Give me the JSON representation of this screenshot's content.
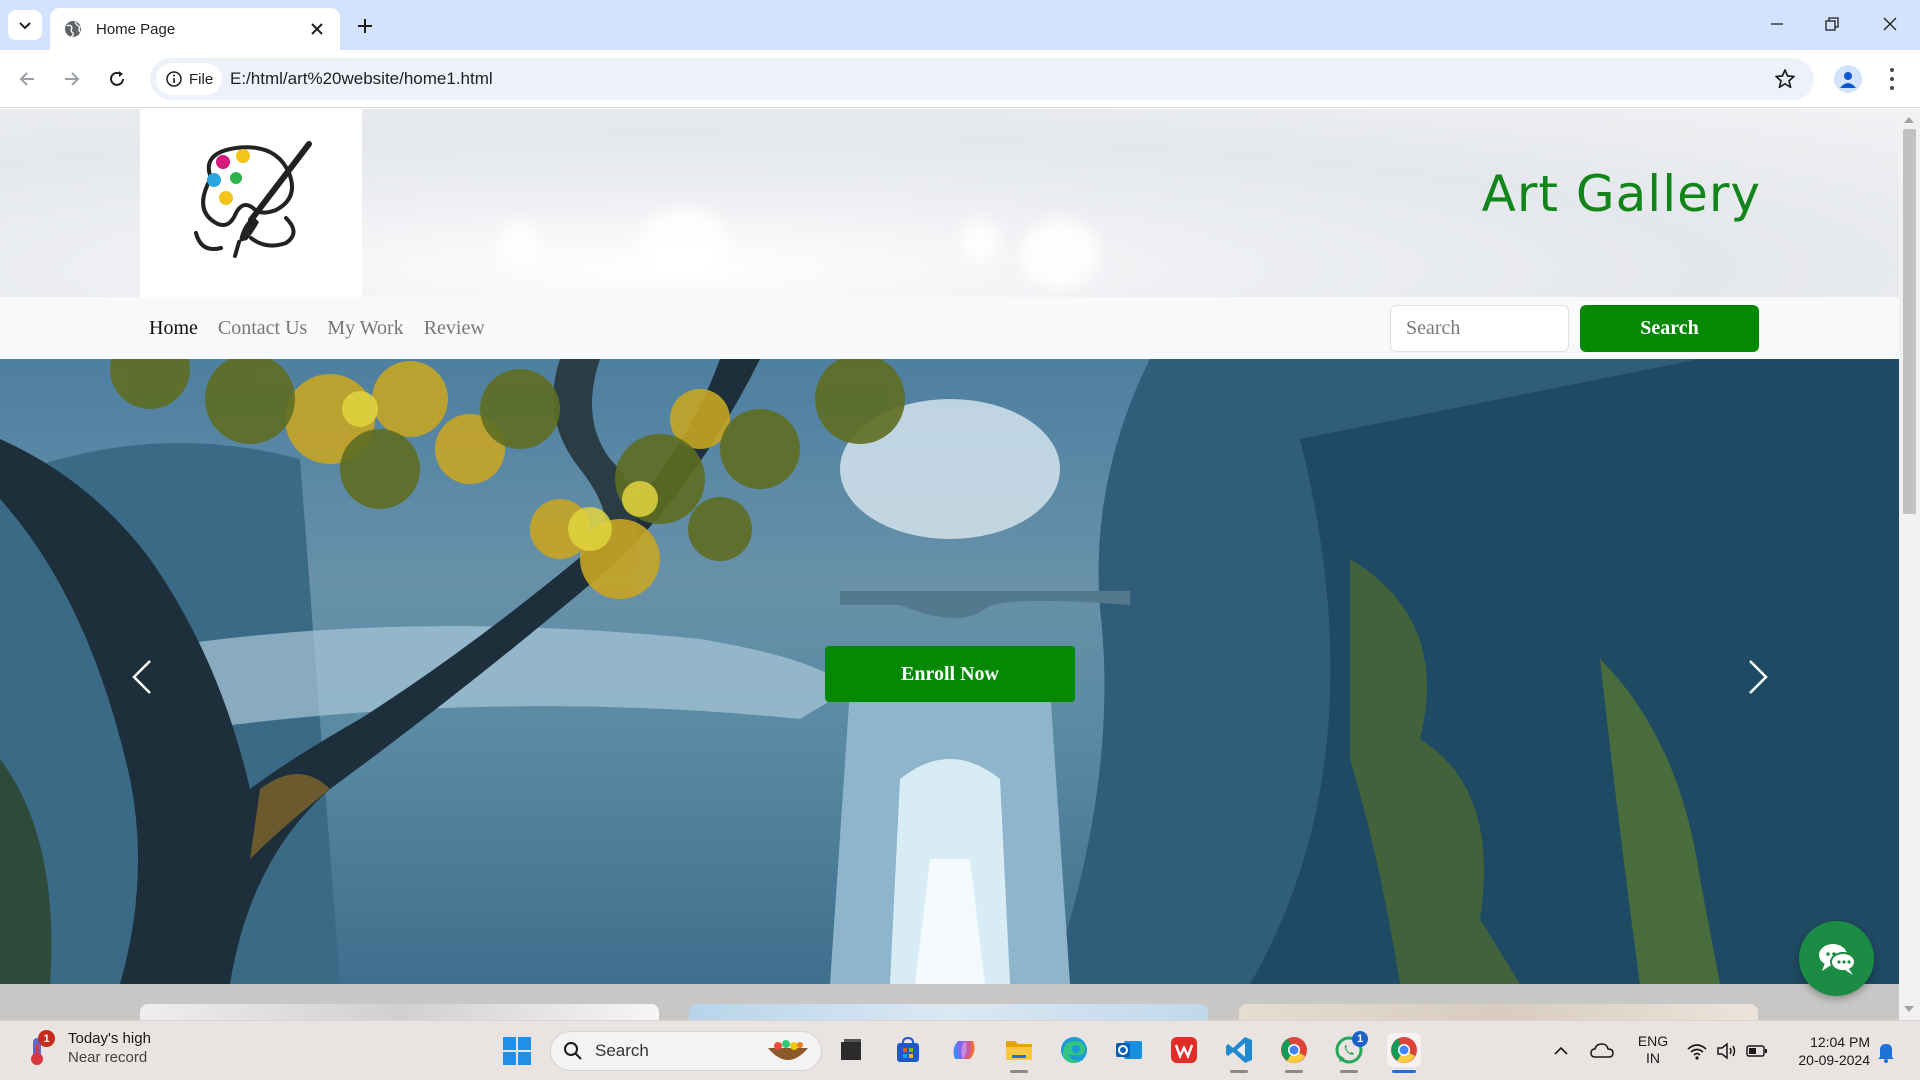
{
  "browser": {
    "tab_title": "Home Page",
    "site_chip_label": "File",
    "url": "E:/html/art%20website/home1.html"
  },
  "site": {
    "brand_title": "Art Gallery",
    "logo_icon": "palette-brush-icon",
    "nav_links": [
      "Home",
      "Contact Us",
      "My Work",
      "Review"
    ],
    "active_nav": "Home",
    "search_placeholder": "Search",
    "search_button": "Search",
    "hero_button": "Enroll Now",
    "accent_color": "#058905",
    "brand_color": "#11851a"
  },
  "taskbar": {
    "weather_title": "Today's high",
    "weather_subtitle": "Near record",
    "weather_badge": "1",
    "search_label": "Search",
    "whatsapp_badge": "1",
    "lang_line1": "ENG",
    "lang_line2": "IN",
    "time": "12:04 PM",
    "date": "20-09-2024"
  }
}
